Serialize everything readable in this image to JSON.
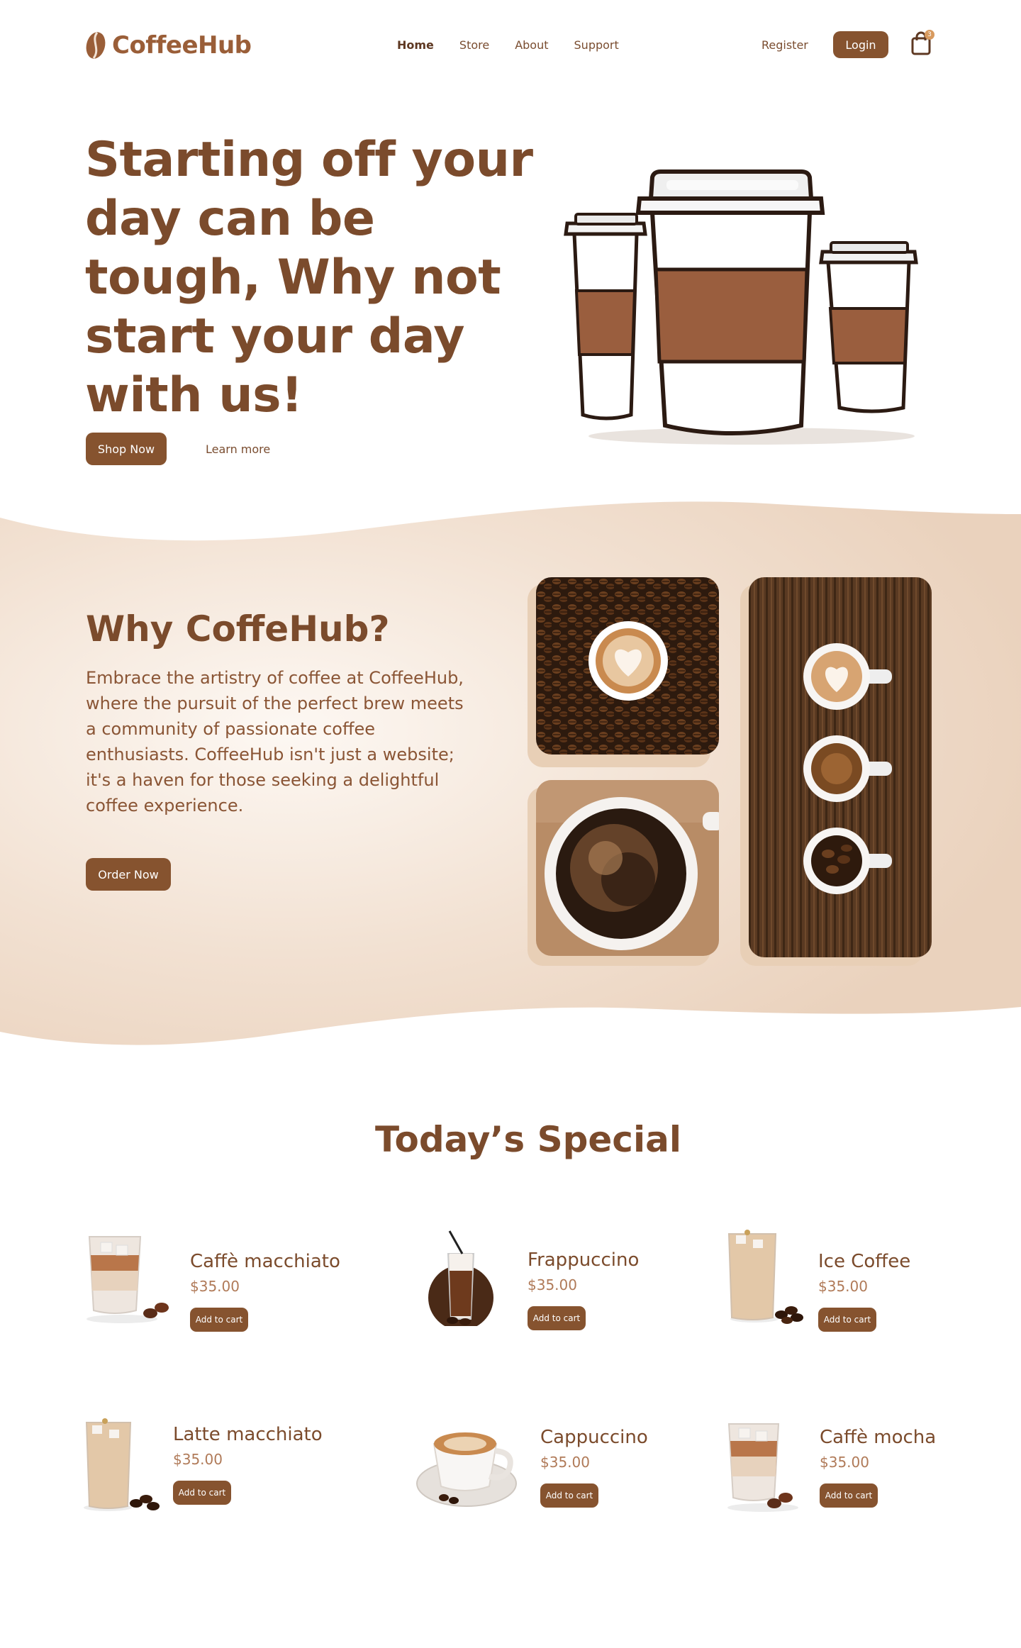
{
  "brand": {
    "name": "CoffeeHub"
  },
  "nav": {
    "links": [
      "Home",
      "Store",
      "About",
      "Support"
    ],
    "register": "Register",
    "login": "Login",
    "cart_count": "3"
  },
  "hero": {
    "title": "Starting off your day can be tough, Why not start your day with us!",
    "shop_now": "Shop Now",
    "learn_more": "Learn more"
  },
  "why": {
    "title": "Why CoffeHub?",
    "text": "Embrace the artistry of coffee at CoffeeHub, where the pursuit of the perfect brew meets a community of passionate coffee enthusiasts. CoffeeHub isn't just a website; it's a haven for those seeking a delightful coffee experience.",
    "order_now": "Order Now"
  },
  "specials": {
    "title": "Today’s Special",
    "add_to_cart": "Add to cart",
    "items": [
      {
        "name": "Caffè macchiato",
        "price": "$35.00"
      },
      {
        "name": "Frappuccino",
        "price": "$35.00"
      },
      {
        "name": "Ice Coffee",
        "price": "$35.00"
      },
      {
        "name": "Latte macchiato",
        "price": "$35.00"
      },
      {
        "name": "Cappuccino",
        "price": "$35.00"
      },
      {
        "name": "Caffè mocha",
        "price": "$35.00"
      }
    ]
  },
  "colors": {
    "primary": "#86532f",
    "heading": "#7b4b2c",
    "section_bg": "#f0dccb",
    "price": "#b07a58"
  }
}
